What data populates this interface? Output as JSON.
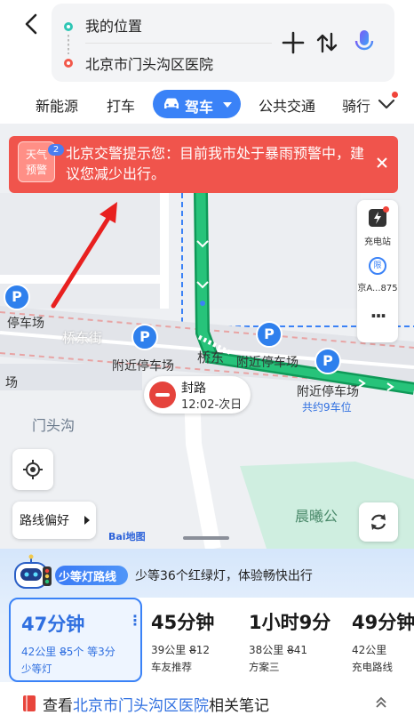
{
  "header": {
    "start": "我的位置",
    "end": "北京市门头沟区医院"
  },
  "tabs": {
    "items": [
      "新能源",
      "打车",
      "公共交通",
      "骑行"
    ],
    "active": "驾车"
  },
  "alert": {
    "badge_line1": "天气",
    "badge_line2": "预警",
    "badge_count": "2",
    "message": "北京交警提示您：目前我市处于暴雨预警中，建议您减少出行。"
  },
  "map": {
    "labels": {
      "parking_left": "停车场",
      "qiaodong_street_1": "桥东街",
      "nearby_parking_1": "附近停车场",
      "qiaodong_street_2": "桥东",
      "nearby_parking_2": "附近停车场",
      "nearby_parking_3": "附近停车场",
      "parking_spaces": "共约9车位",
      "left_edge": "场",
      "mentougou": "门头沟",
      "chenxi": "晨曦公"
    },
    "tools": {
      "charging": "充电站",
      "station": "京A...875",
      "more": "···"
    },
    "closure": {
      "title": "封路",
      "time": "12:02-次日"
    },
    "route_pref": "路线偏好",
    "logo": "Bai地图"
  },
  "panel": {
    "tip_badge": "少等灯路线",
    "tip_text": "少等36个红绿灯，体验畅快出行",
    "routes": [
      {
        "time": "47分钟",
        "detail": "42公里 8̶5个 等3分",
        "tag": "少等灯",
        "selected": true
      },
      {
        "time": "45分钟",
        "detail": "39公里 8̶12",
        "tag": "车友推荐",
        "selected": false
      },
      {
        "time": "1小时9分",
        "detail": "38公里 8̶41",
        "tag": "方案三",
        "selected": false
      },
      {
        "time": "49分钟",
        "detail": "42公里",
        "tag": "充电路线",
        "selected": false
      }
    ],
    "notes": {
      "prefix": "查看",
      "place": "北京市门头沟区医院",
      "suffix": "相关笔记"
    }
  },
  "colors": {
    "accent": "#3a82f7",
    "alert": "#f0544c",
    "route": "#16b371",
    "closure": "#e5433c"
  }
}
